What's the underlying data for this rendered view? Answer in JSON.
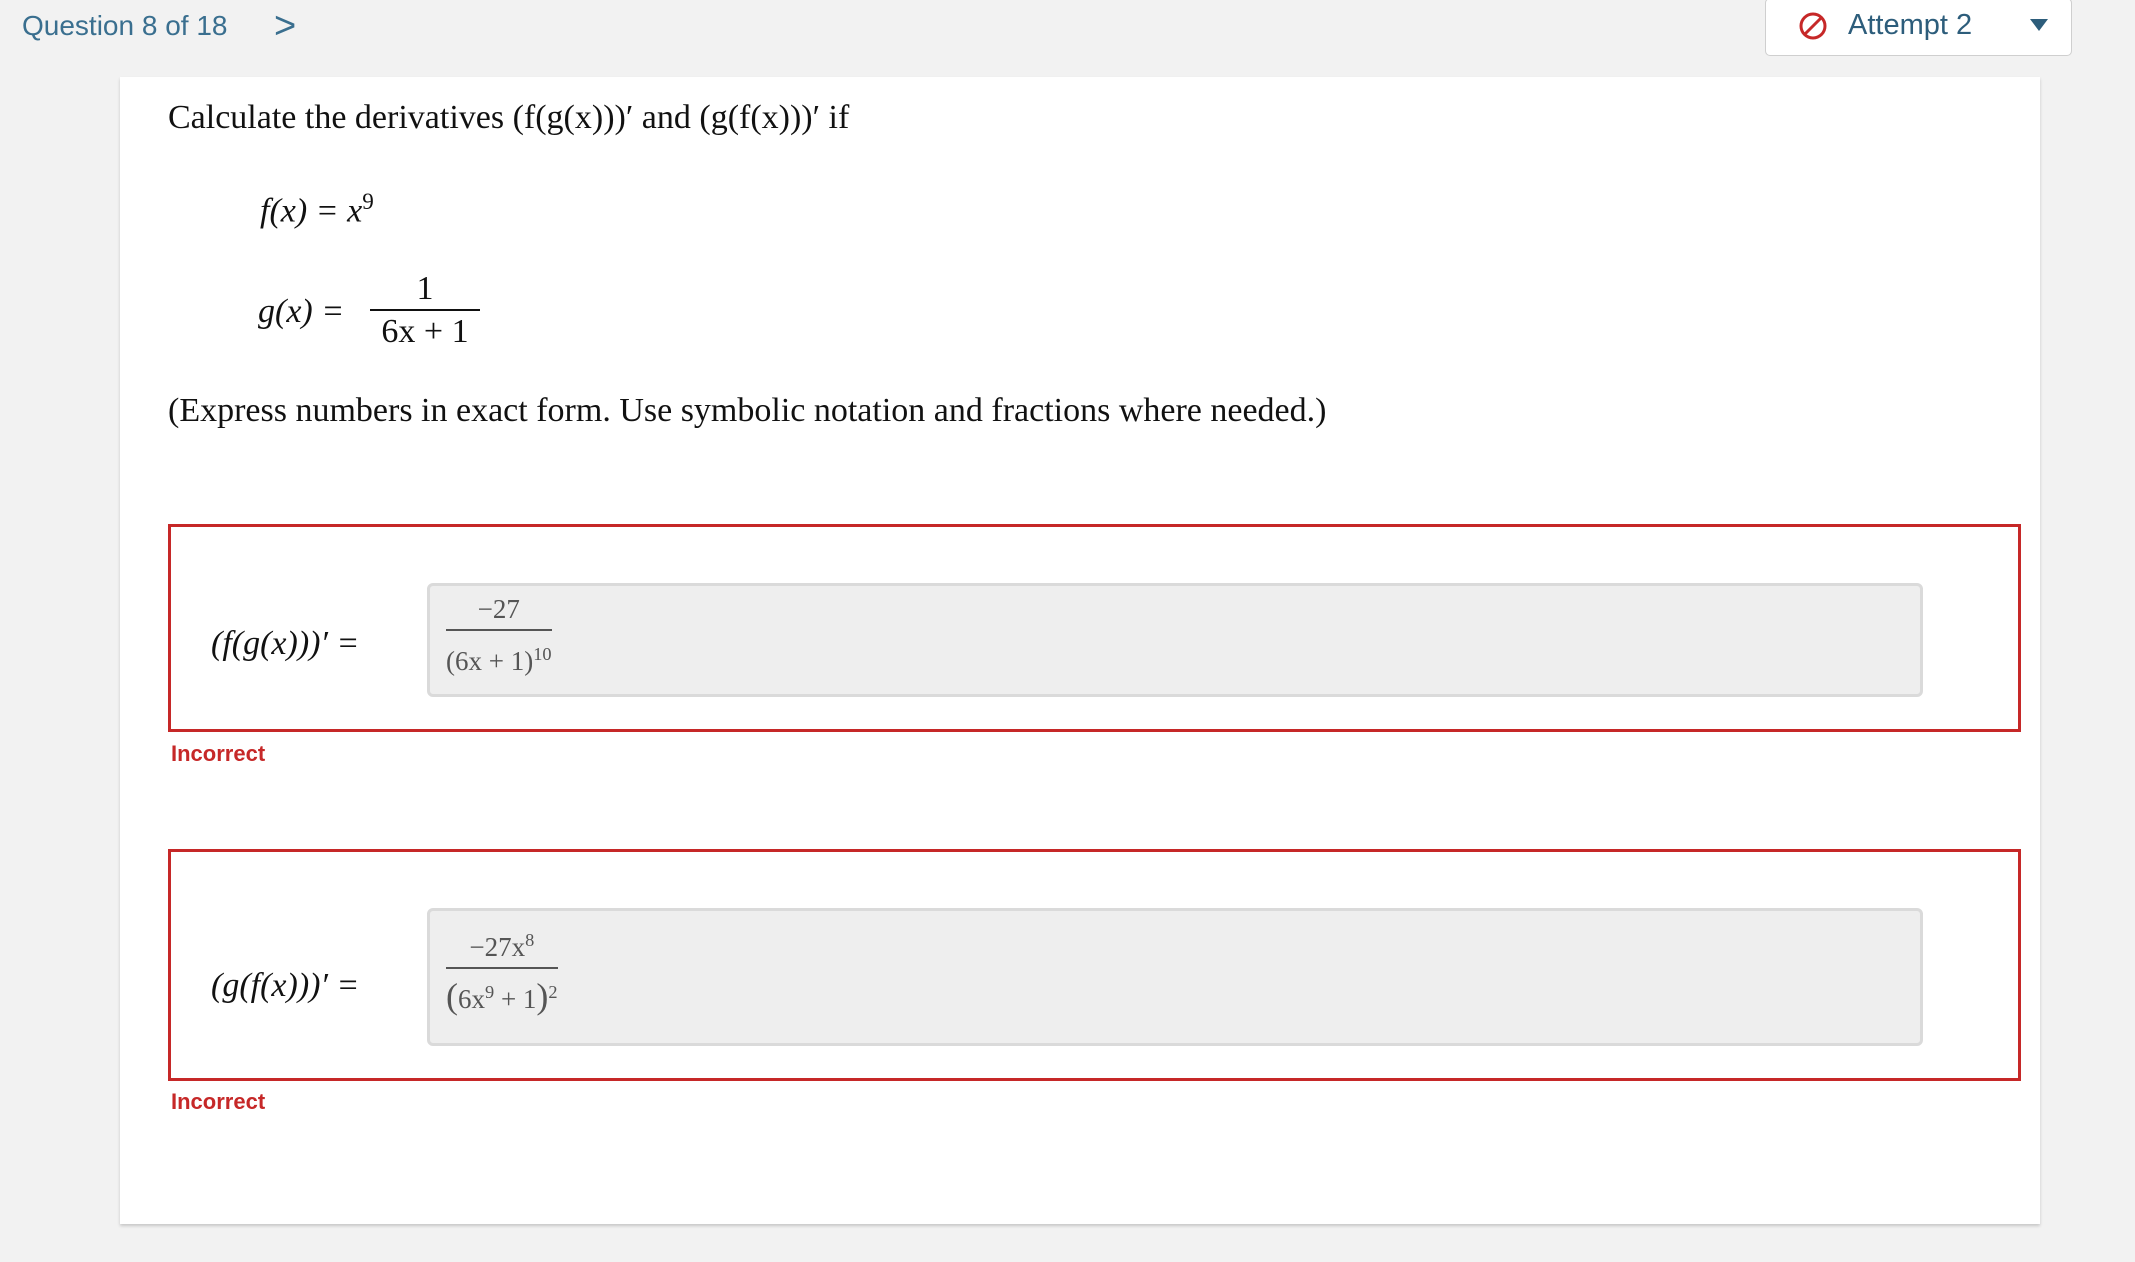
{
  "header": {
    "question_label": "Question 8 of 18",
    "next_glyph": ">",
    "attempt_label": "Attempt 2"
  },
  "question": {
    "prompt": "Calculate the derivatives (f(g(x)))′ and (g(f(x)))′ if",
    "f_def_lhs": "f(x) = x",
    "f_def_exp": "9",
    "g_def_lhs": "g(x) =",
    "g_num": "1",
    "g_den": "6x + 1",
    "instructions": "(Express numbers in exact form. Use symbolic notation and fractions where needed.)"
  },
  "answers": [
    {
      "lhs": "(f(g(x)))′ =",
      "num": "−27",
      "den_base": "(6x + 1)",
      "den_exp": "10",
      "status": "Incorrect"
    },
    {
      "lhs": "(g(f(x)))′ =",
      "num_base": "−27x",
      "num_exp": "8",
      "den_base": "6x",
      "den_inner_exp": "9",
      "den_tail": " + 1",
      "den_exp": "2",
      "status": "Incorrect"
    }
  ],
  "colors": {
    "error": "#c62828",
    "link": "#3a6f8f"
  },
  "icons": {
    "next": "chevron-right-icon",
    "attempt": "ban-icon",
    "dropdown": "caret-down-icon"
  }
}
